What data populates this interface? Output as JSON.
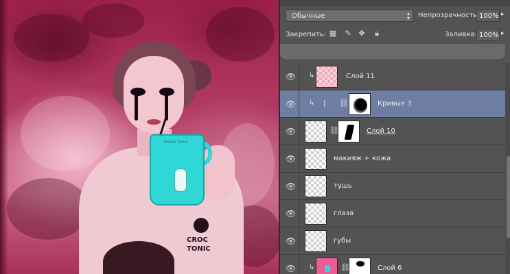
{
  "canvas": {
    "mug_brand": "Green Tonic",
    "shirt_print": [
      "CROC",
      "TONIC"
    ]
  },
  "layers_panel": {
    "blend_mode": "Обычные",
    "opacity_label": "Непрозрачность:",
    "opacity_value": "100%",
    "lock_label": "Закрепить:",
    "fill_label": "Заливка:",
    "fill_value": "100%",
    "layers": [
      {
        "name": "Слой 11",
        "visible": true,
        "clipped": true,
        "selected": false
      },
      {
        "name": "Кривые 3",
        "visible": true,
        "clipped": true,
        "selected": true
      },
      {
        "name": "Слой 10",
        "visible": true,
        "clipped": false,
        "selected": false
      },
      {
        "name": "макияж + кожа",
        "visible": true,
        "clipped": false,
        "selected": false
      },
      {
        "name": "тушь",
        "visible": true,
        "clipped": false,
        "selected": false
      },
      {
        "name": "глаза",
        "visible": true,
        "clipped": false,
        "selected": false
      },
      {
        "name": "губы",
        "visible": true,
        "clipped": false,
        "selected": false
      },
      {
        "name": "Слой 6",
        "visible": true,
        "clipped": true,
        "selected": false
      }
    ]
  },
  "icons": {
    "eye": "eye-icon",
    "lock_transparent": "lock-transparent-pixels-icon",
    "lock_image": "lock-image-pixels-icon",
    "lock_position": "lock-position-icon",
    "lock_all": "lock-all-icon",
    "link": "chain-link-icon",
    "clip": "clipping-arrow-icon",
    "curves": "curves-adjustment-icon"
  },
  "colors": {
    "selected_layer": "#6d7ea2",
    "panel_bg": "#535353",
    "canvas_tint": "#c0456f"
  }
}
